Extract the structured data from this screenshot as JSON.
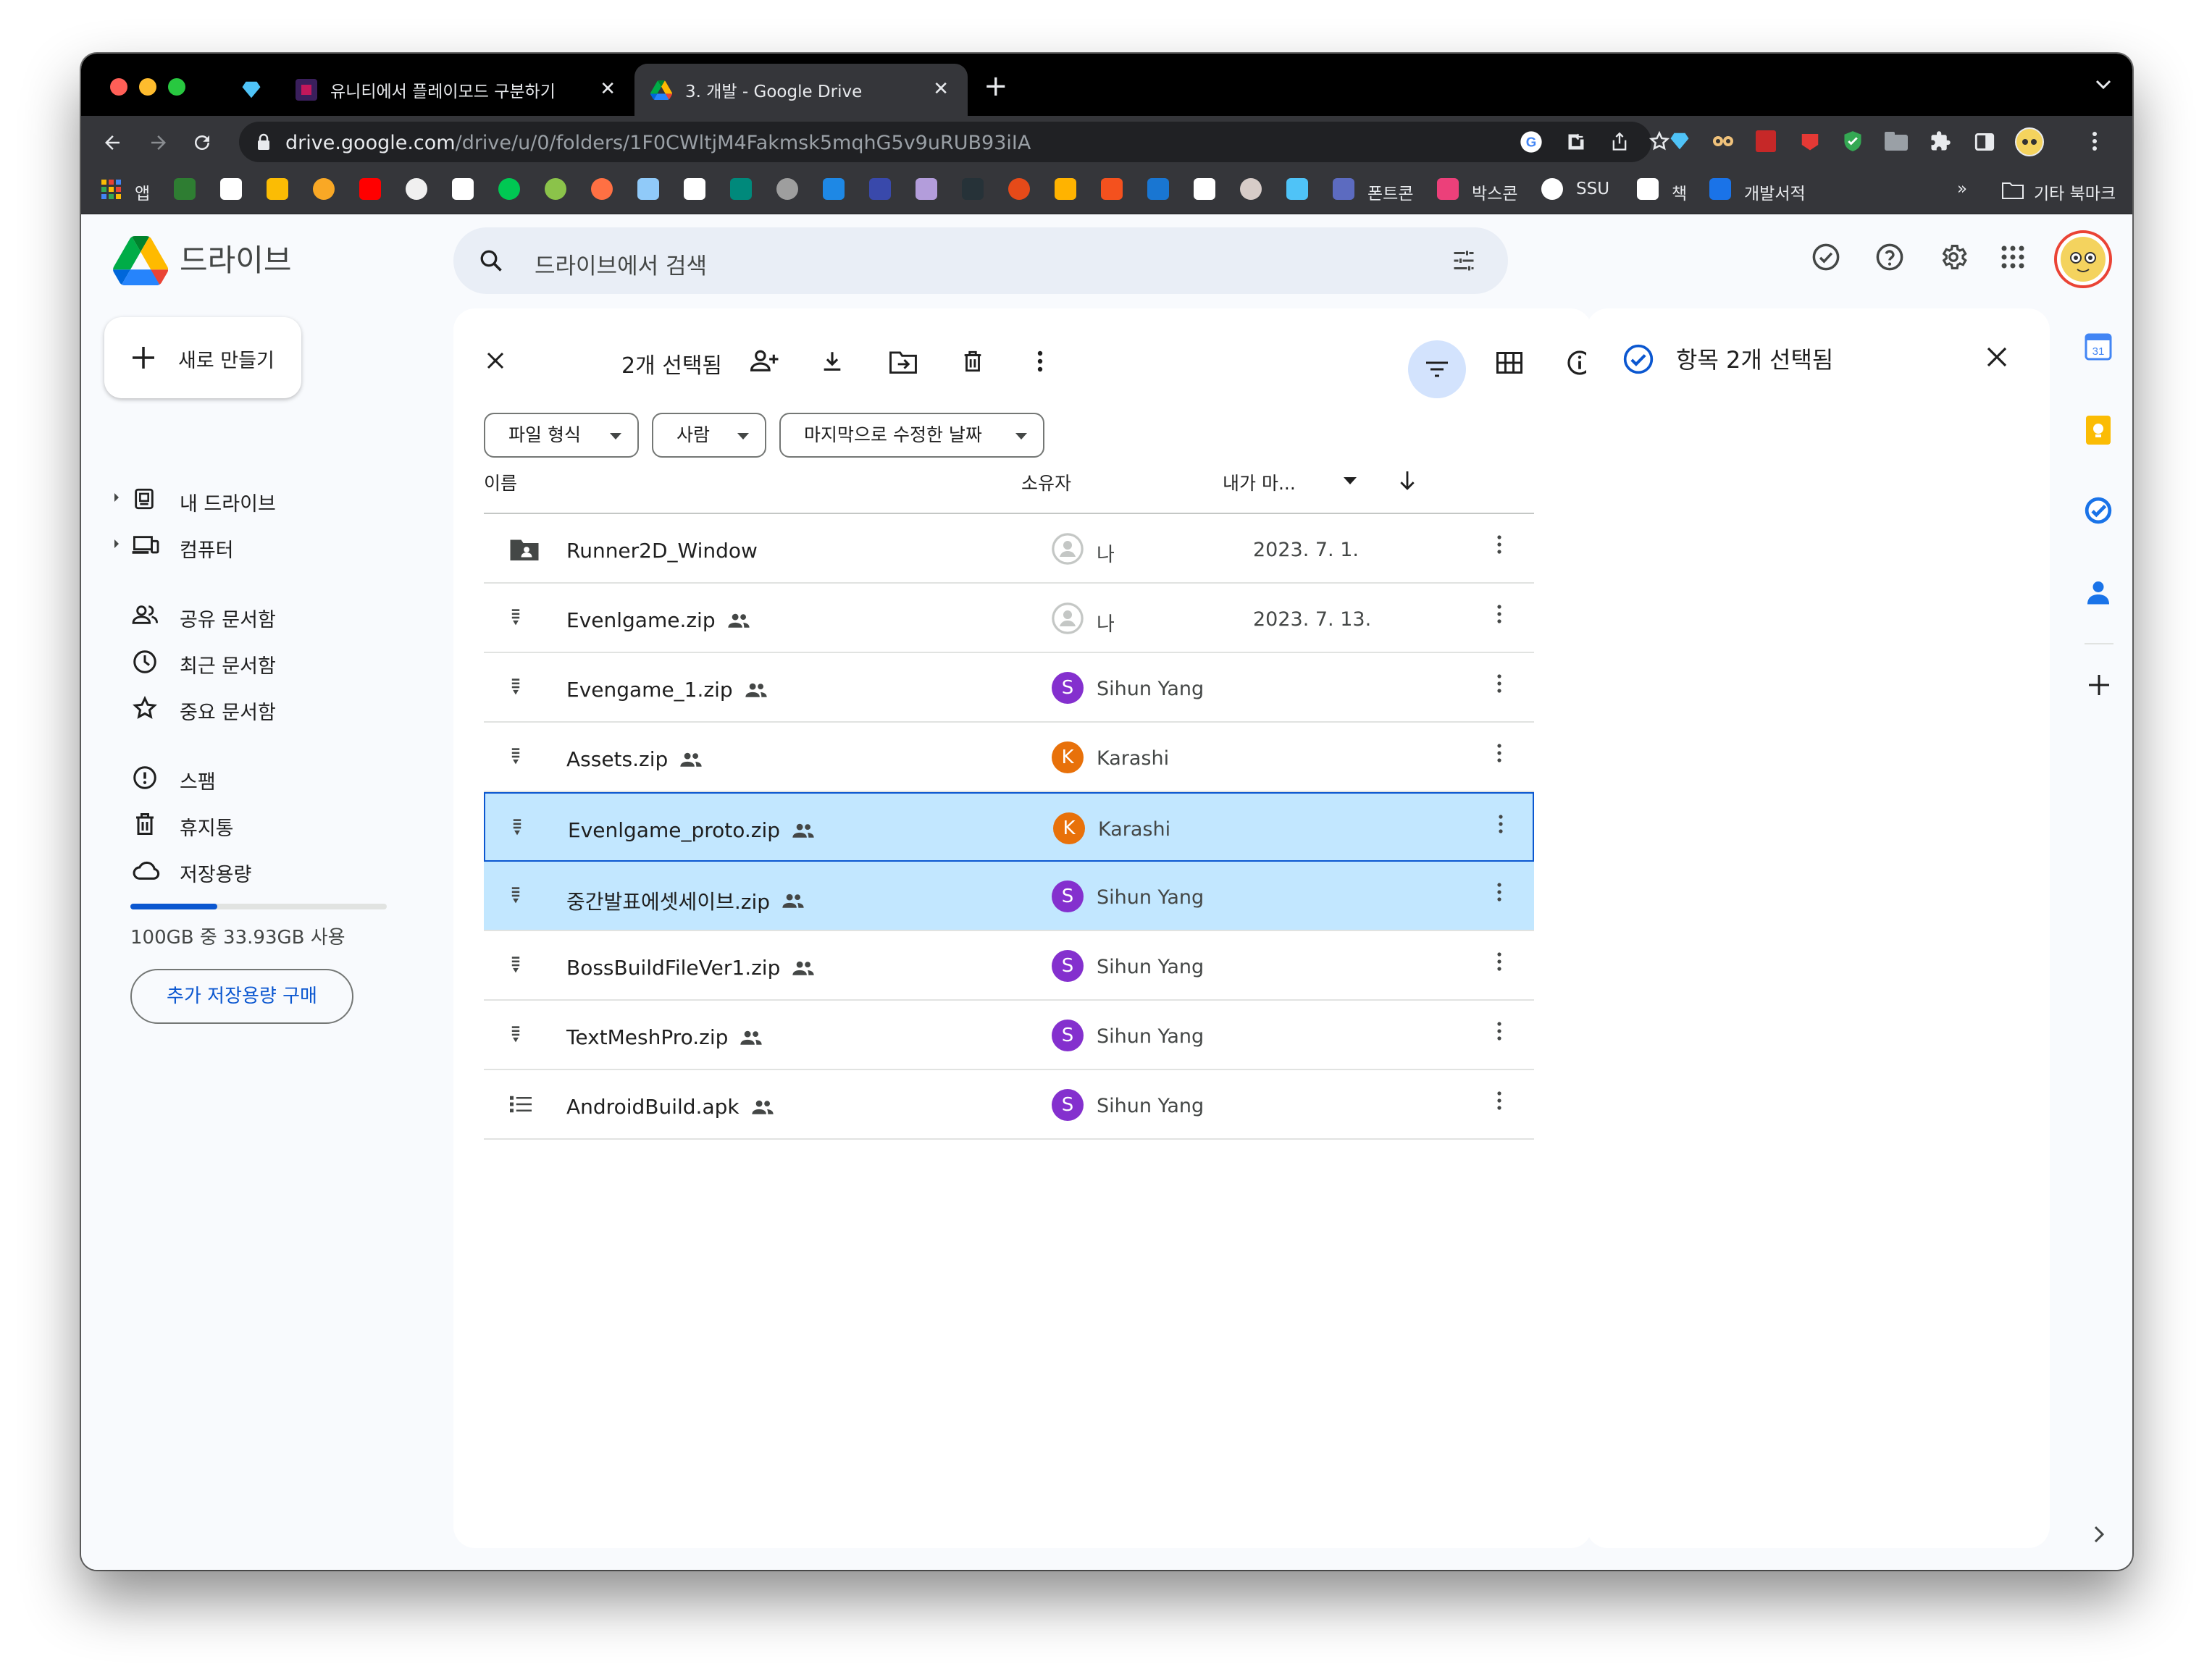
{
  "browser": {
    "tabs": [
      {
        "title": ""
      },
      {
        "title": "유니티에서 플레이모드 구분하기"
      },
      {
        "title": "3. 개발 - Google Drive"
      }
    ],
    "url_host": "drive.google.com",
    "url_path": "/drive/u/0/folders/1F0CWltjM4Fakmsk5mqhG5v9uRUB93iIA",
    "bookmarks": {
      "apps": "앱",
      "fontcon": "폰트콘",
      "boxcon": "박스콘",
      "ssu": "SSU",
      "book": "책",
      "devbooks": "개발서적",
      "more": "»",
      "other": "기타 북마크"
    }
  },
  "drive": {
    "logo": "드라이브",
    "search_placeholder": "드라이브에서 검색",
    "new_button": "새로 만들기",
    "nav": {
      "my_drive": "내 드라이브",
      "computers": "컴퓨터",
      "shared": "공유 문서함",
      "recent": "최근 문서함",
      "starred": "중요 문서함",
      "spam": "스팸",
      "trash": "휴지통",
      "storage": "저장용량"
    },
    "storage_text": "100GB 중 33.93GB 사용",
    "storage_fraction": 0.34,
    "buy_storage": "추가 저장용량 구매",
    "selection_count": "2개 선택됨",
    "filters": [
      "파일 형식",
      "사람",
      "마지막으로 수정한 날짜"
    ],
    "columns": {
      "name": "이름",
      "owner": "소유자",
      "modified": "내가 마..."
    },
    "files": [
      {
        "name": "Runner2D_Window",
        "owner": "나",
        "date": "2023. 7. 1.",
        "initial": ""
      },
      {
        "name": "Evenlgame.zip",
        "owner": "나",
        "date": "2023. 7. 13.",
        "initial": ""
      },
      {
        "name": "Evengame_1.zip",
        "owner": "Sihun Yang",
        "date": "",
        "initial": "S"
      },
      {
        "name": "Assets.zip",
        "owner": "Karashi",
        "date": "",
        "initial": "K"
      },
      {
        "name": "Evenlgame_proto.zip",
        "owner": "Karashi",
        "date": "",
        "initial": "K"
      },
      {
        "name": "중간발표에셋세이브.zip",
        "owner": "Sihun Yang",
        "date": "",
        "initial": "S"
      },
      {
        "name": "BossBuildFileVer1.zip",
        "owner": "Sihun Yang",
        "date": "",
        "initial": "S"
      },
      {
        "name": "TextMeshPro.zip",
        "owner": "Sihun Yang",
        "date": "",
        "initial": "S"
      },
      {
        "name": "AndroidBuild.apk",
        "owner": "Sihun Yang",
        "date": "",
        "initial": "S"
      }
    ],
    "details_title": "항목 2개 선택됨"
  },
  "colors": {
    "accent": "#0b57d0",
    "selected_row": "#c2e7ff",
    "purple_avatar": "#8430ce",
    "orange_avatar": "#e8710a"
  }
}
